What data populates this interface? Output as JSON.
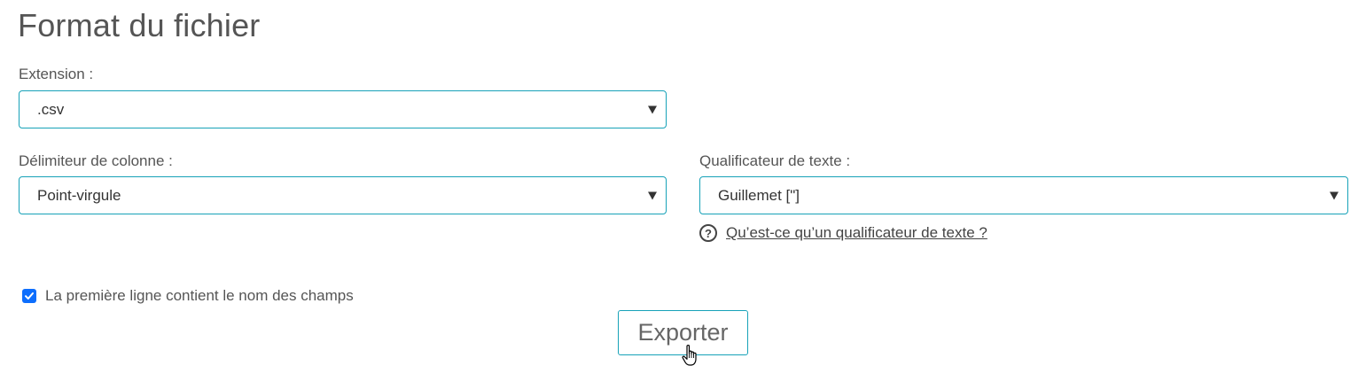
{
  "section": {
    "title": "Format du fichier"
  },
  "extension": {
    "label": "Extension :",
    "value": ".csv"
  },
  "column_delimiter": {
    "label": "Délimiteur de colonne :",
    "value": "Point-virgule"
  },
  "text_qualifier": {
    "label": "Qualificateur de texte :",
    "value": "Guillemet [\"]",
    "help_icon": "question-circle-icon",
    "help_link": "Qu’est-ce qu’un qualificateur de texte ?"
  },
  "header_row": {
    "label": "La première ligne contient le nom des champs",
    "checked": true
  },
  "actions": {
    "export_label": "Exporter"
  },
  "colors": {
    "accent_border": "#17a2b8",
    "checkbox": "#0d6efd",
    "text": "#555555"
  }
}
